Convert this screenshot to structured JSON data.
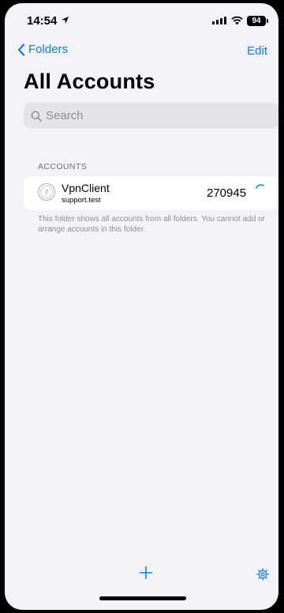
{
  "status_bar": {
    "time": "14:54",
    "battery": "94",
    "icons": [
      "location-arrow-icon",
      "cellular-signal-icon",
      "wifi-icon",
      "battery-icon"
    ]
  },
  "nav": {
    "back_label": "Folders",
    "edit_label": "Edit"
  },
  "page": {
    "title": "All Accounts"
  },
  "search": {
    "placeholder": "Search",
    "value": ""
  },
  "accounts_section": {
    "header": "ACCOUNTS",
    "items": [
      {
        "name": "VpnClient",
        "subtitle": "support.test",
        "code": "270945",
        "icon": "question-mark-circle-icon"
      }
    ],
    "footer": "This folder shows all accounts from all folders. You cannot add or arrange accounts in this folder."
  },
  "toolbar": {
    "icons": [
      "plus-icon",
      "gear-icon"
    ]
  },
  "colors": {
    "accent": "#0a7aff",
    "background": "#f2f2f7",
    "secondary_text": "#8e8e93"
  }
}
